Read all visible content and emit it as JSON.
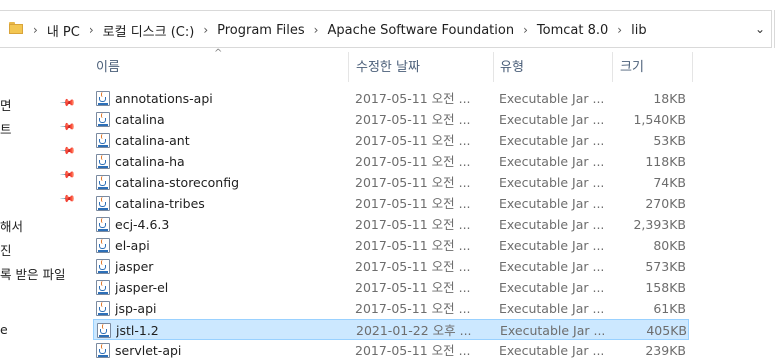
{
  "address_bar": {
    "breadcrumbs": [
      "내 PC",
      "로컬 디스크 (C:)",
      "Program Files",
      "Apache Software Foundation",
      "Tomcat 8.0",
      "lib"
    ],
    "separator": "›",
    "dropdown": "⌄"
  },
  "navigation": {
    "items": [
      "면",
      "트",
      "",
      "",
      "",
      "해서",
      "진",
      "록 받은 파일",
      "",
      "e"
    ],
    "pin_glyph": "📌"
  },
  "columns": {
    "name": "이름",
    "date": "수정한 날짜",
    "type": "유형",
    "size": "크기",
    "sort_indicator": "^"
  },
  "files": [
    {
      "name": "annotations-api",
      "date": "2017-05-11 오전 ...",
      "type": "Executable Jar ...",
      "size": "18KB"
    },
    {
      "name": "catalina",
      "date": "2017-05-11 오전 ...",
      "type": "Executable Jar ...",
      "size": "1,540KB"
    },
    {
      "name": "catalina-ant",
      "date": "2017-05-11 오전 ...",
      "type": "Executable Jar ...",
      "size": "53KB"
    },
    {
      "name": "catalina-ha",
      "date": "2017-05-11 오전 ...",
      "type": "Executable Jar ...",
      "size": "118KB"
    },
    {
      "name": "catalina-storeconfig",
      "date": "2017-05-11 오전 ...",
      "type": "Executable Jar ...",
      "size": "74KB"
    },
    {
      "name": "catalina-tribes",
      "date": "2017-05-11 오전 ...",
      "type": "Executable Jar ...",
      "size": "270KB"
    },
    {
      "name": "ecj-4.6.3",
      "date": "2017-05-11 오전 ...",
      "type": "Executable Jar ...",
      "size": "2,393KB"
    },
    {
      "name": "el-api",
      "date": "2017-05-11 오전 ...",
      "type": "Executable Jar ...",
      "size": "80KB"
    },
    {
      "name": "jasper",
      "date": "2017-05-11 오전 ...",
      "type": "Executable Jar ...",
      "size": "573KB"
    },
    {
      "name": "jasper-el",
      "date": "2017-05-11 오전 ...",
      "type": "Executable Jar ...",
      "size": "158KB"
    },
    {
      "name": "jsp-api",
      "date": "2017-05-11 오전 ...",
      "type": "Executable Jar ...",
      "size": "61KB"
    },
    {
      "name": "jstl-1.2",
      "date": "2021-01-22 오후 ...",
      "type": "Executable Jar ...",
      "size": "405KB",
      "selected": true
    },
    {
      "name": "servlet-api",
      "date": "2017-05-11 오전 ...",
      "type": "Executable Jar ...",
      "size": "239KB"
    }
  ],
  "colors": {
    "selection_bg": "#cce8ff",
    "selection_border": "#99d1ff",
    "header_text": "#4c607a"
  }
}
